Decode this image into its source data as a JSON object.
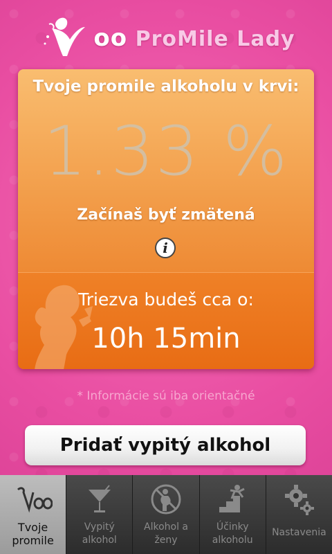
{
  "app": {
    "logo_part1": "oo",
    "logo_part2": "ProMile",
    "logo_part3": "Lady"
  },
  "card": {
    "title": "Tvoje promile alkoholu v krvi:",
    "value": "1.33 %",
    "status": "Začínaš byť zmätená",
    "info_icon": "info-icon",
    "sober_label": "Triezva budeš cca o:",
    "sober_time": "10h 15min"
  },
  "disclaimer": "* Informácie sú iba orientačné",
  "add_button": "Pridať vypitý alkohol",
  "tabs": [
    {
      "label1": "Tvoje",
      "label2": "promile",
      "icon": "voo-logo-icon",
      "active": true
    },
    {
      "label1": "Vypitý",
      "label2": "alkohol",
      "icon": "cocktail-glass-icon",
      "active": false
    },
    {
      "label1": "Alkohol a",
      "label2": "ženy",
      "icon": "pregnant-woman-icon",
      "active": false
    },
    {
      "label1": "Účinky",
      "label2": "alkoholu",
      "icon": "falling-stairs-icon",
      "active": false
    },
    {
      "label1": "Nastavenia",
      "label2": "",
      "icon": "gears-icon",
      "active": false
    }
  ],
  "colors": {
    "background": "#e94ea2",
    "card_top": "#f4a654",
    "card_bottom": "#e86c14",
    "tabbar": "#333333",
    "active_tab": "#a8a8a8"
  }
}
